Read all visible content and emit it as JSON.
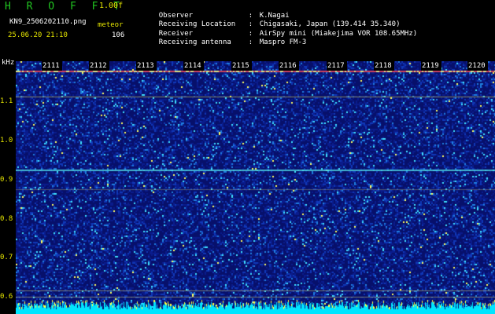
{
  "header": {
    "app_title": "H R O F F T",
    "version": "1.00f",
    "filename": "KN9_2506202110.png",
    "meteor_label": "meteor",
    "datetime": "25.06.20 21:10",
    "meteor_count": "106"
  },
  "info": [
    {
      "key": "Observer",
      "sep": ":",
      "value": "K.Nagai"
    },
    {
      "key": "Receiving Location",
      "sep": ":",
      "value": "Chigasaki, Japan (139.414 35.340)"
    },
    {
      "key": "Receiver",
      "sep": ":",
      "value": "AirSpy mini (Miakejima VOR 108.65MHz)"
    },
    {
      "key": "Receiving antenna",
      "sep": ":",
      "value": "Maspro FM-3"
    }
  ],
  "y_axis": {
    "unit": "kHz",
    "ticks": [
      "1.1",
      "1.0",
      "0.9",
      "0.8",
      "0.7",
      "0.6"
    ],
    "range": [
      0.57,
      1.195
    ]
  },
  "time_axis": {
    "ticks": [
      "2111",
      "2112",
      "2113",
      "2114",
      "2115",
      "2116",
      "2117",
      "2118",
      "2119",
      "2120"
    ]
  },
  "colors": {
    "background": "#000000",
    "spectrum_base": "#07106b",
    "text_green": "#21c421",
    "text_yellow": "#e4e400",
    "baseline_cyan": "#00e5ff"
  }
}
